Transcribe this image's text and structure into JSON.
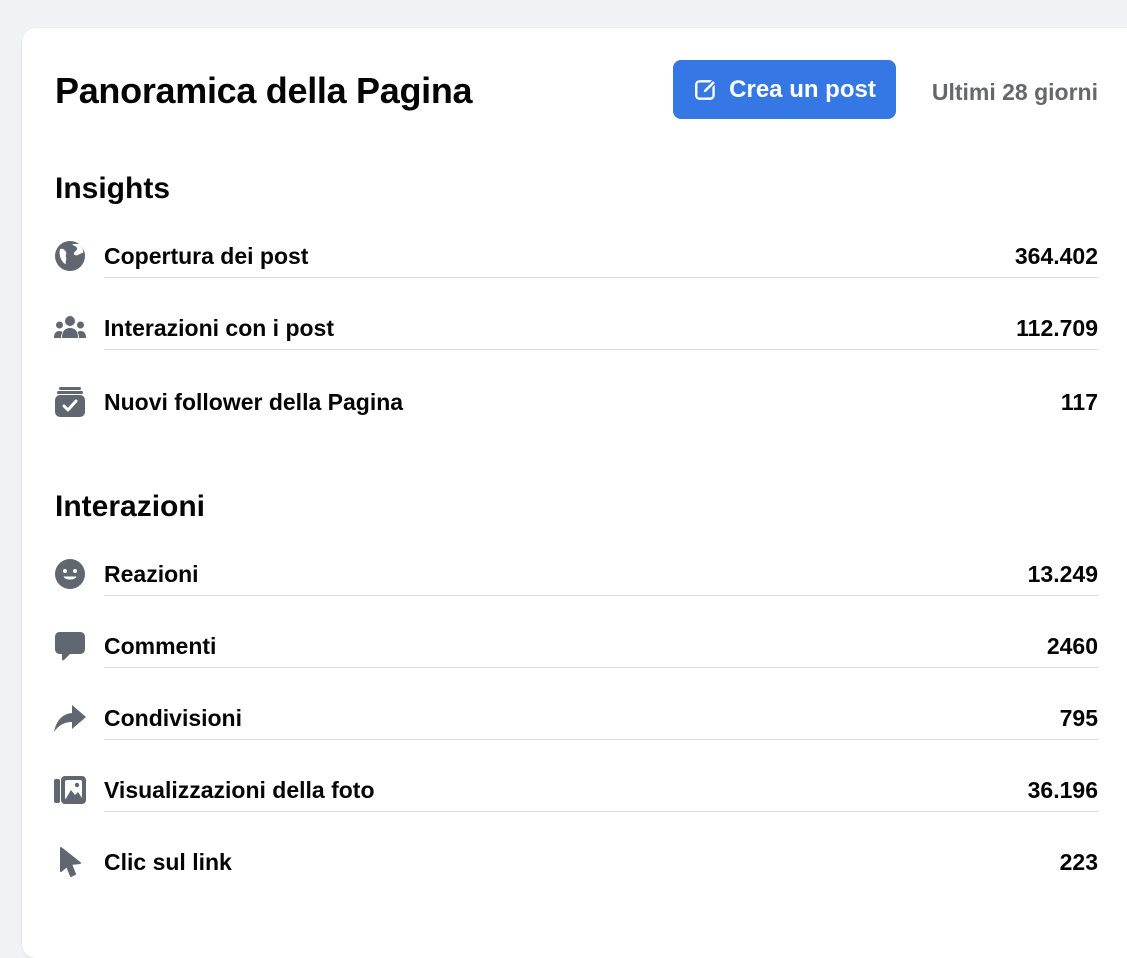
{
  "header": {
    "title": "Panoramica della Pagina",
    "create_post_label": "Crea un post",
    "period_label": "Ultimi 28 giorni"
  },
  "insights": {
    "title": "Insights",
    "rows": [
      {
        "label": "Copertura dei post",
        "value": "364.402",
        "icon": "globe-icon"
      },
      {
        "label": "Interazioni con i post",
        "value": "112.709",
        "icon": "people-icon"
      },
      {
        "label": "Nuovi follower della Pagina",
        "value": "117",
        "icon": "follow-check-icon"
      }
    ]
  },
  "interactions": {
    "title": "Interazioni",
    "rows": [
      {
        "label": "Reazioni",
        "value": "13.249",
        "icon": "smiley-icon"
      },
      {
        "label": "Commenti",
        "value": "2460",
        "icon": "comment-icon"
      },
      {
        "label": "Condivisioni",
        "value": "795",
        "icon": "share-arrow-icon"
      },
      {
        "label": "Visualizzazioni della foto",
        "value": "36.196",
        "icon": "photo-icon"
      },
      {
        "label": "Clic sul link",
        "value": "223",
        "icon": "cursor-icon"
      }
    ]
  },
  "colors": {
    "accent": "#3578e5",
    "icon": "#606770",
    "muted_text": "#65676b"
  }
}
